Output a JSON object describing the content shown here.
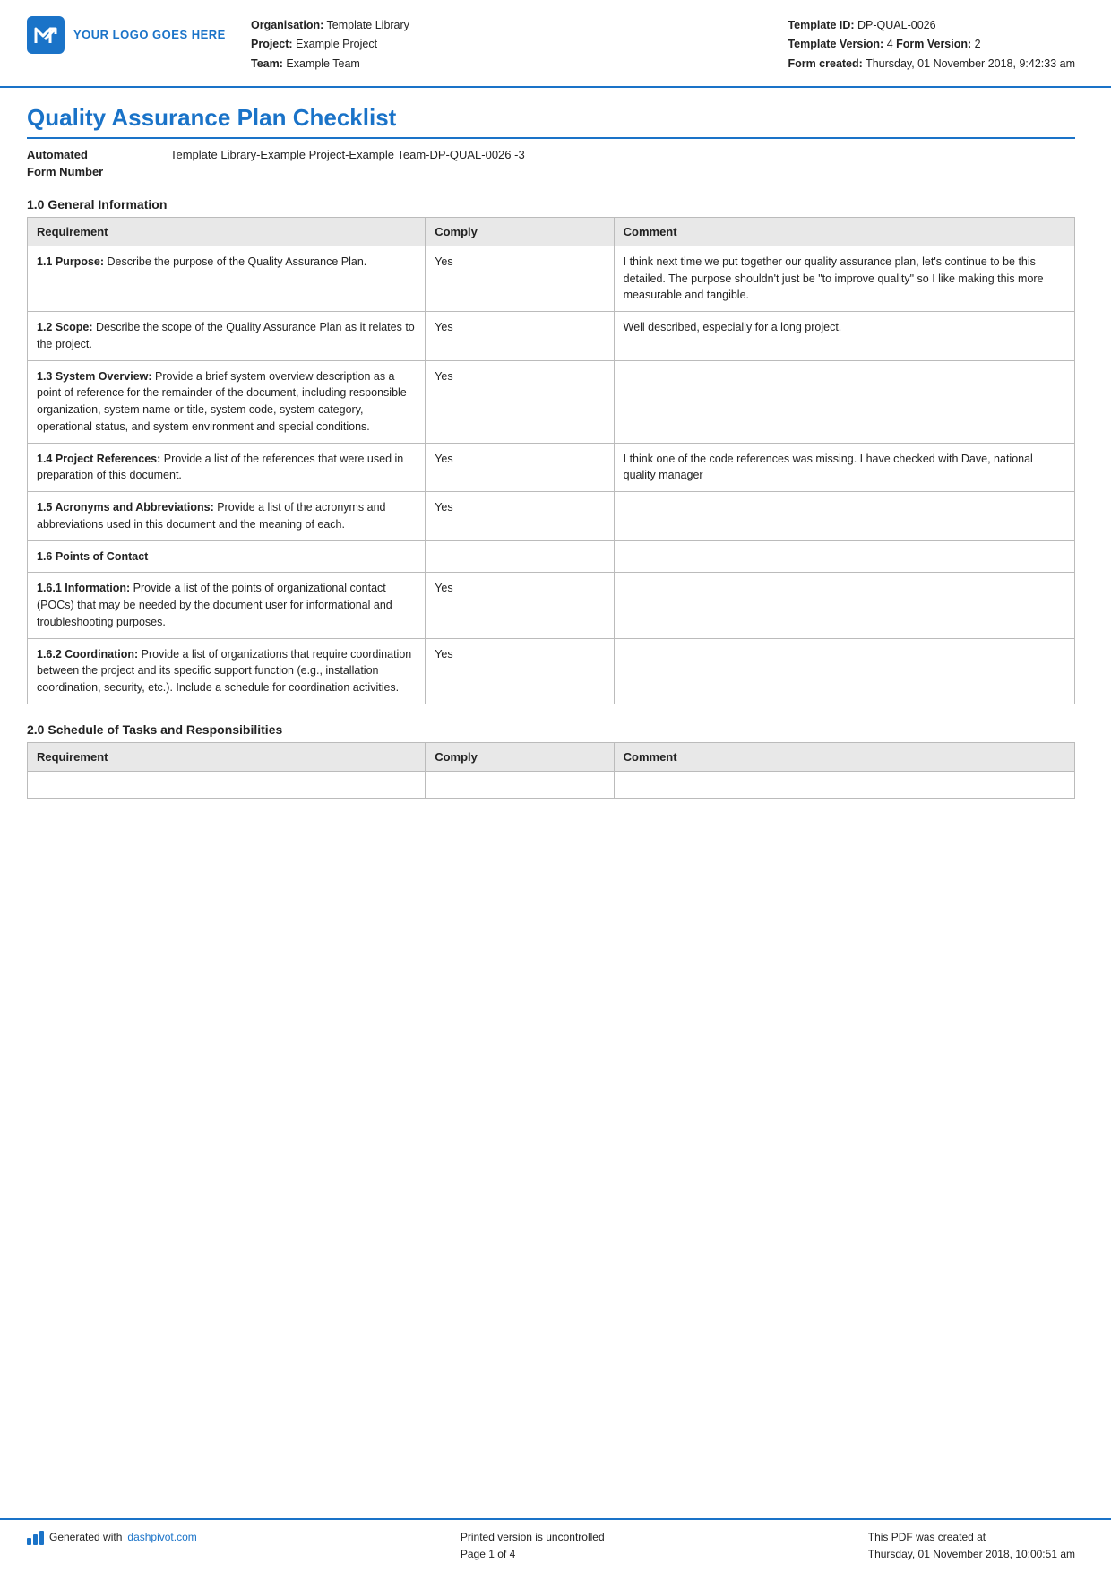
{
  "header": {
    "logo_text": "YOUR LOGO GOES HERE",
    "org_label": "Organisation:",
    "org_value": "Template Library",
    "project_label": "Project:",
    "project_value": "Example Project",
    "team_label": "Team:",
    "team_value": "Example Team",
    "template_id_label": "Template ID:",
    "template_id_value": "DP-QUAL-0026",
    "template_version_label": "Template Version:",
    "template_version_value": "4",
    "form_version_label": "Form Version:",
    "form_version_value": "2",
    "form_created_label": "Form created:",
    "form_created_value": "Thursday, 01 November 2018, 9:42:33 am"
  },
  "document": {
    "title": "Quality Assurance Plan Checklist",
    "form_number_label": "Automated\nForm Number",
    "form_number_value": "Template Library-Example Project-Example Team-DP-QUAL-0026  -3"
  },
  "section1": {
    "title": "1.0 General Information",
    "table": {
      "headers": [
        "Requirement",
        "Comply",
        "Comment"
      ],
      "rows": [
        {
          "req_bold": "1.1 Purpose:",
          "req_text": " Describe the purpose of the Quality Assurance Plan.",
          "comply": "Yes",
          "comment": "I think next time we put together our quality assurance plan, let's continue to be this detailed. The purpose shouldn't just be \"to improve quality\" so I like making this more measurable and tangible."
        },
        {
          "req_bold": "1.2 Scope:",
          "req_text": " Describe the scope of the Quality Assurance Plan as it relates to the project.",
          "comply": "Yes",
          "comment": "Well described, especially for a long project."
        },
        {
          "req_bold": "1.3 System Overview:",
          "req_text": " Provide a brief system overview description as a point of reference for the remainder of the document, including responsible organization, system name or title, system code, system category, operational status, and system environment and special conditions.",
          "comply": "Yes",
          "comment": ""
        },
        {
          "req_bold": "1.4 Project References:",
          "req_text": " Provide a list of the references that were used in preparation of this document.",
          "comply": "Yes",
          "comment": "I think one of the code references was missing. I have checked with Dave, national quality manager"
        },
        {
          "req_bold": "1.5 Acronyms and Abbreviations:",
          "req_text": " Provide a list of the acronyms and abbreviations used in this document and the meaning of each.",
          "comply": "Yes",
          "comment": ""
        },
        {
          "req_bold": "1.6 Points of Contact",
          "req_text": "",
          "comply": "",
          "comment": ""
        },
        {
          "req_bold": "1.6.1 Information:",
          "req_text": " Provide a list of the points of organizational contact (POCs) that may be needed by the document user for informational and troubleshooting purposes.",
          "comply": "Yes",
          "comment": ""
        },
        {
          "req_bold": "1.6.2 Coordination:",
          "req_text": " Provide a list of organizations that require coordination between the project and its specific support function (e.g., installation coordination, security, etc.). Include a schedule for coordination activities.",
          "comply": "Yes",
          "comment": ""
        }
      ]
    }
  },
  "section2": {
    "title": "2.0 Schedule of Tasks and Responsibilities",
    "table": {
      "headers": [
        "Requirement",
        "Comply",
        "Comment"
      ],
      "rows": []
    }
  },
  "footer": {
    "generated_text": "Generated with",
    "site_link": "dashpivot.com",
    "center_text": "Printed version is uncontrolled\nPage 1 of 4",
    "right_text": "This PDF was created at\nThursday, 01 November 2018, 10:00:51 am"
  }
}
